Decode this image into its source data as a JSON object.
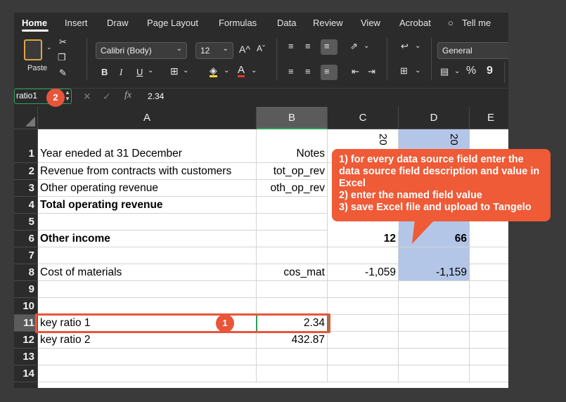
{
  "ribbon_tabs": [
    "Home",
    "Insert",
    "Draw",
    "Page Layout",
    "Formulas",
    "Data",
    "Review",
    "View",
    "Acrobat",
    "Tell me"
  ],
  "ribbon": {
    "paste_label": "Paste",
    "font_name": "Calibri (Body)",
    "font_size": "12",
    "grow_font": "A^",
    "shrink_font": "Aˇ",
    "bold": "B",
    "italic": "I",
    "underline": "U",
    "font_color_letter": "A",
    "number_format": "General",
    "percent": "%",
    "comma": "9"
  },
  "formula_bar": {
    "name_box": "ratio1",
    "formula": "2.34",
    "fx": "fx"
  },
  "columns": [
    "A",
    "B",
    "C",
    "D",
    "E"
  ],
  "rows": [
    "1",
    "2",
    "3",
    "4",
    "5",
    "6",
    "7",
    "8",
    "9",
    "10",
    "11",
    "12",
    "13",
    "14"
  ],
  "cells": {
    "A1": "Year eneded at 31 December",
    "B1": "Notes",
    "C1": "20",
    "D1": "20",
    "A2": "Revenue from contracts with customers",
    "B2": "tot_op_rev",
    "A3": "Other operating revenue",
    "B3": "oth_op_rev",
    "A4": "Total operating revenue",
    "A6": "Other income",
    "C6": "12",
    "D6": "66",
    "A8": "Cost of materials",
    "B8": "cos_mat",
    "C8": "-1,059",
    "D8": "-1,159",
    "A11": "key ratio 1",
    "B11": "2.34",
    "A12": "key ratio 2",
    "B12": "432.87"
  },
  "badges": {
    "one": "1",
    "two": "2"
  },
  "callout": {
    "line1": "1) for every data source field enter the data source field description and value in Excel",
    "line2": "2) enter the named field value",
    "line3": "3) save Excel file and upload to Tangelo"
  },
  "colors": {
    "accent_red": "#ef5a37",
    "selection_green": "#2f9e5c",
    "column_d_fill": "#b4c6e7"
  }
}
